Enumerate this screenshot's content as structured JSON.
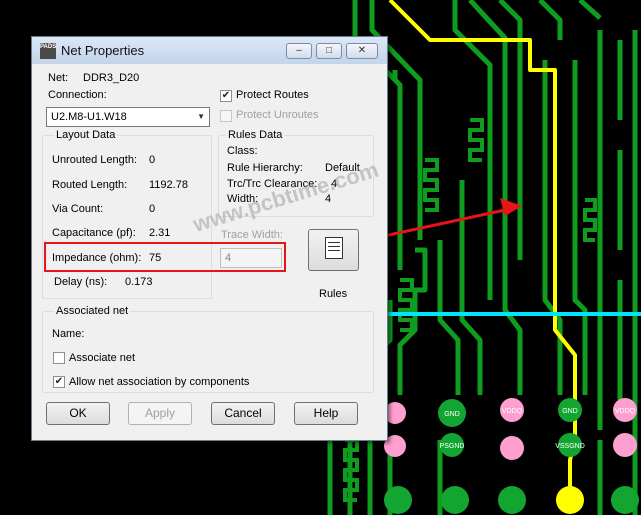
{
  "window": {
    "title": "Net Properties",
    "app_icon_text": "PADS"
  },
  "net": {
    "label": "Net:",
    "value": "DDR3_D20"
  },
  "connection": {
    "label": "Connection:",
    "selected": "U2.M8-U1.W18"
  },
  "protect_routes": {
    "label": "Protect Routes",
    "checked": true
  },
  "protect_unroutes": {
    "label": "Protect Unroutes",
    "checked": false,
    "enabled": false
  },
  "layout_data": {
    "title": "Layout Data",
    "rows": [
      {
        "label": "Unrouted Length:",
        "value": "0"
      },
      {
        "label": "Routed Length:",
        "value": "1192.78"
      },
      {
        "label": "Via Count:",
        "value": "0"
      },
      {
        "label": "Capacitance (pf):",
        "value": "2.31"
      },
      {
        "label": "Impedance (ohm):",
        "value": "75"
      },
      {
        "label": "Delay (ns):",
        "value": "0.173"
      }
    ]
  },
  "rules_data": {
    "title": "Rules Data",
    "class_label": "Class:",
    "hierarchy_label": "Rule Hierarchy:",
    "hierarchy_value": "Default",
    "clearance_label": "Trc/Trc Clearance:",
    "clearance_value": "4",
    "width_label": "Width:",
    "width_value": "4"
  },
  "trace_width": {
    "label": "Trace Width:",
    "value": "4"
  },
  "rules_button": {
    "label": "Rules"
  },
  "associated_net": {
    "title": "Associated net",
    "name_label": "Name:",
    "associate_label": "Associate net",
    "associate_checked": false,
    "allow_label": "Allow net association by components",
    "allow_checked": true
  },
  "buttons": {
    "ok": "OK",
    "apply": "Apply",
    "cancel": "Cancel",
    "help": "Help"
  },
  "watermark": "www.pcbtime.com",
  "pads": {
    "gnd": "GND",
    "vddq": "VDDQ",
    "psgnd": "PSGND",
    "vssgnd": "VSSGND"
  },
  "colors": {
    "board_bg": "#000000",
    "trace": "#0f9d1f",
    "highlight": "#ffff00",
    "cyan": "#00e5ff",
    "pad_pink": "#ff9fd0",
    "pad_green": "#12a532",
    "callout": "#e8141a"
  }
}
